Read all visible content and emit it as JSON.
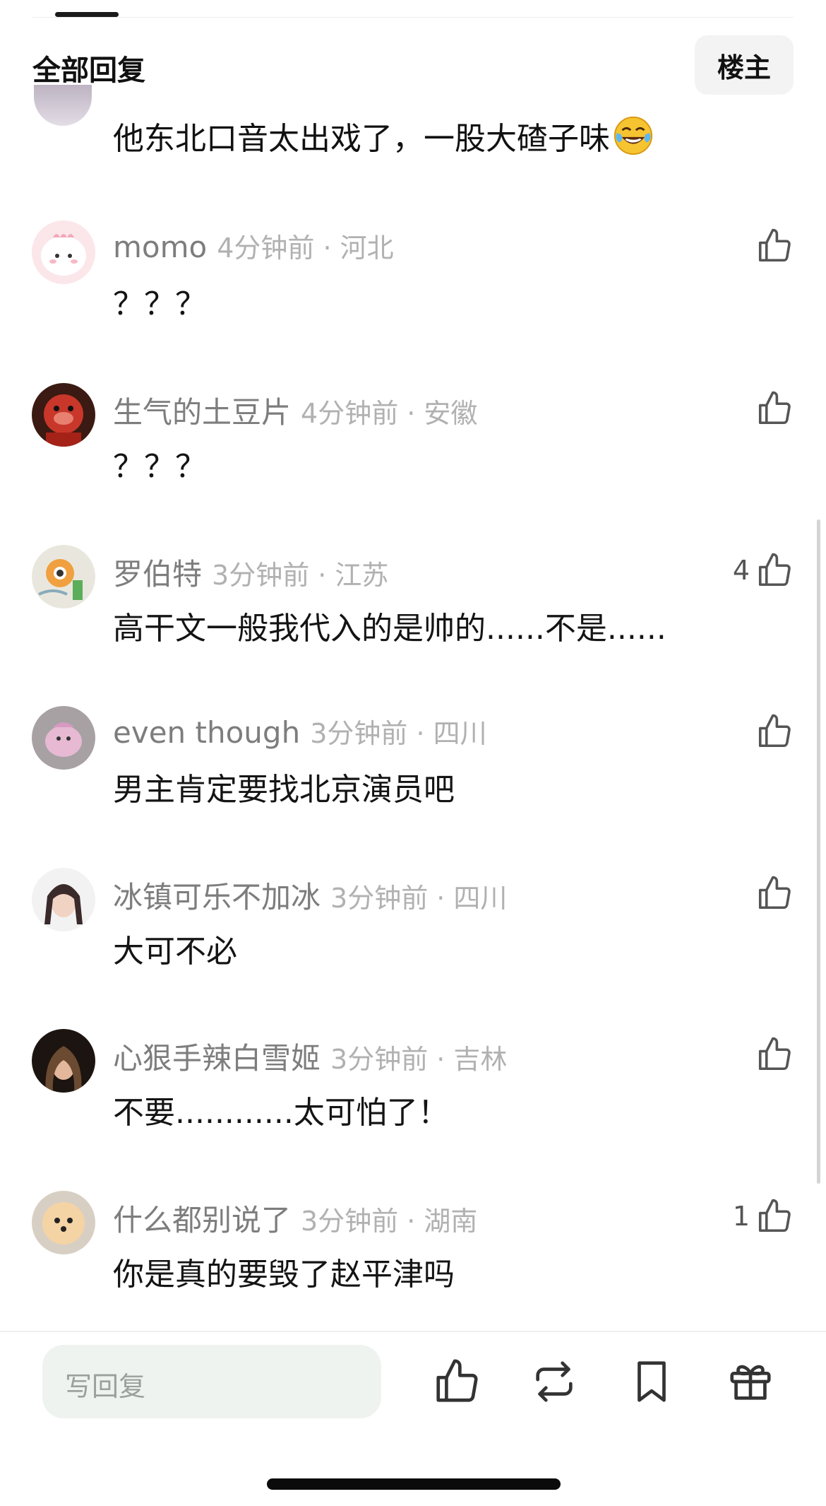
{
  "header": {
    "title": "全部回复",
    "owner_filter": "楼主"
  },
  "partial_comment": {
    "text": "他东北口音太出戏了，一股大碴子味"
  },
  "comments": [
    {
      "username": "momo",
      "time": "4分钟前 · 河北",
      "text": "？？？",
      "likes": ""
    },
    {
      "username": "生气的土豆片",
      "time": "4分钟前 · 安徽",
      "text": "？？？",
      "likes": ""
    },
    {
      "username": "罗伯特",
      "time": "3分钟前 · 江苏",
      "text": "高干文一般我代入的是帅的......不是......",
      "likes": "4"
    },
    {
      "username": "even though",
      "time": "3分钟前 · 四川",
      "text": "男主肯定要找北京演员吧",
      "likes": ""
    },
    {
      "username": "冰镇可乐不加冰",
      "time": "3分钟前 · 四川",
      "text": "大可不必",
      "likes": ""
    },
    {
      "username": "心狠手辣白雪姬",
      "time": "3分钟前 · 吉林",
      "text": "不要............太可怕了！",
      "likes": ""
    },
    {
      "username": "什么都别说了",
      "time": "3分钟前 · 湖南",
      "text": "你是真的要毁了赵平津吗",
      "likes": "1"
    }
  ],
  "bottom_bar": {
    "reply_placeholder": "写回复",
    "icons": [
      "thumbs-up-icon",
      "repost-icon",
      "bookmark-icon",
      "gift-icon"
    ]
  },
  "colors": {
    "username": "#7d7d7d",
    "meta": "#b1b1b1",
    "reply_box_bg": "#eef3ef",
    "owner_button_bg": "#f3f3f3"
  }
}
